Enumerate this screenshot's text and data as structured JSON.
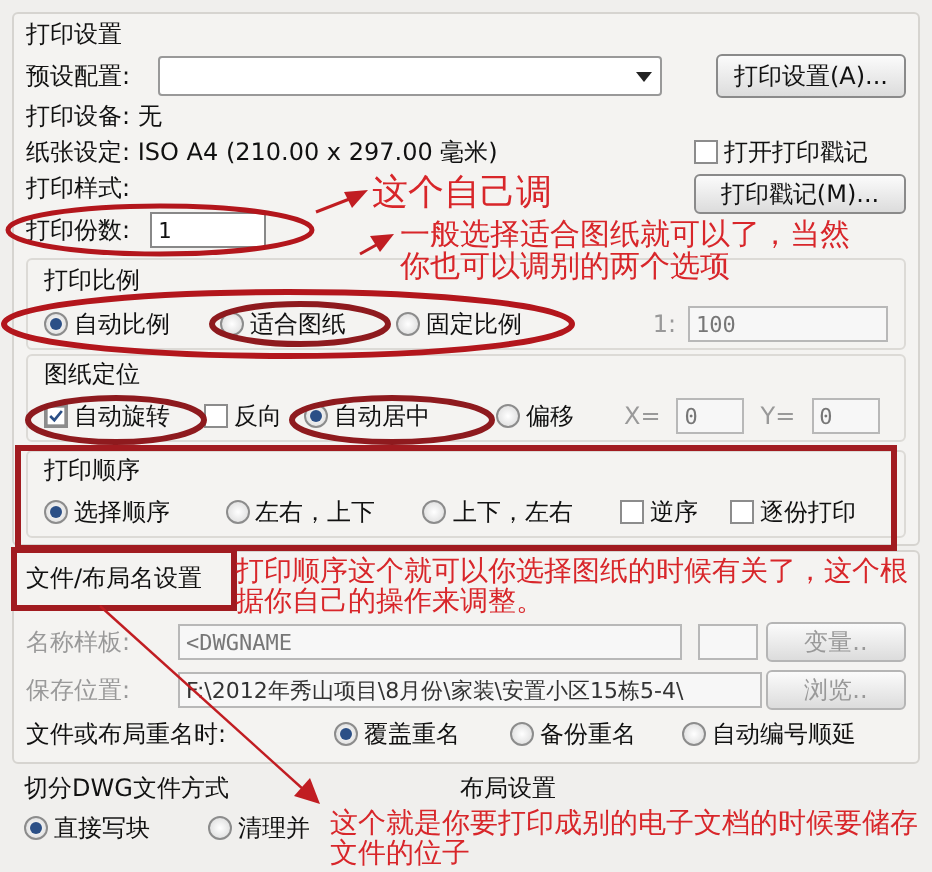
{
  "print_settings": {
    "title": "打印设置",
    "preset": {
      "label": "预设配置:"
    },
    "setup_button": "打印设置(A)...",
    "device": {
      "label": "打印设备:",
      "value": "无"
    },
    "paper": {
      "label": "纸张设定:",
      "value": "ISO A4 (210.00 x 297.00 毫米)"
    },
    "style": {
      "label": "打印样式:"
    },
    "stamp_checkbox": {
      "label": "打开打印戳记",
      "checked": false
    },
    "stamp_button": "打印戳记(M)...",
    "copies": {
      "label": "打印份数:",
      "value": "1"
    }
  },
  "scale": {
    "title": "打印比例",
    "options": [
      {
        "label": "自动比例",
        "selected": true
      },
      {
        "label": "适合图纸",
        "selected": false
      },
      {
        "label": "固定比例",
        "selected": false
      }
    ],
    "ratio": {
      "label": "1:",
      "value": "100",
      "disabled": true
    }
  },
  "placement": {
    "title": "图纸定位",
    "items": [
      {
        "kind": "checkbox",
        "label": "自动旋转",
        "checked": true
      },
      {
        "kind": "checkbox",
        "label": "反向",
        "checked": false
      },
      {
        "kind": "radio",
        "label": "自动居中",
        "selected": true
      },
      {
        "kind": "radio",
        "label": "偏移",
        "selected": false
      }
    ],
    "offsets": [
      {
        "label": "X=",
        "value": "0",
        "disabled": true
      },
      {
        "label": "Y=",
        "value": "0",
        "disabled": true
      }
    ]
  },
  "order": {
    "title": "打印顺序",
    "items": [
      {
        "kind": "radio",
        "label": "选择顺序",
        "selected": true
      },
      {
        "kind": "radio",
        "label": "左右，上下",
        "selected": false
      },
      {
        "kind": "radio",
        "label": "上下，左右",
        "selected": false
      },
      {
        "kind": "checkbox",
        "label": "逆序",
        "checked": false
      },
      {
        "kind": "checkbox",
        "label": "逐份打印",
        "checked": false
      }
    ]
  },
  "file_naming": {
    "title": "文件/布局名设置",
    "name_template": {
      "label": "名称样板:",
      "value": "<DWGNAME",
      "disabled": true
    },
    "variable_button": "变量..",
    "save_location": {
      "label": "保存位置:",
      "value": "F:\\2012年秀山项目\\8月份\\家装\\安置小区15栋5-4\\",
      "disabled": true
    },
    "browse_button": "浏览..",
    "rename": {
      "label": "文件或布局重名时:",
      "options": [
        {
          "label": "覆盖重名",
          "selected": true
        },
        {
          "label": "备份重名",
          "selected": false
        },
        {
          "label": "自动编号顺延",
          "selected": false
        }
      ]
    }
  },
  "split": {
    "title": "切分DWG文件方式",
    "options": [
      {
        "label": "直接写块",
        "selected": true
      },
      {
        "label": "清理并",
        "selected": false
      }
    ]
  },
  "layout_settings": {
    "title": "布局设置"
  },
  "annotations": [
    {
      "kind": "note",
      "text": "这个自己调"
    },
    {
      "kind": "note",
      "text": "一般选择适合图纸就可以了，当然你也可以调别的两个选项"
    },
    {
      "kind": "note",
      "text": "打印顺序这个就可以你选择图纸的时候有关了，这个根据你自己的操作来调整。"
    },
    {
      "kind": "note",
      "text": "这个就是你要打印成别的电子文档的时候要储存文件的位子"
    }
  ]
}
